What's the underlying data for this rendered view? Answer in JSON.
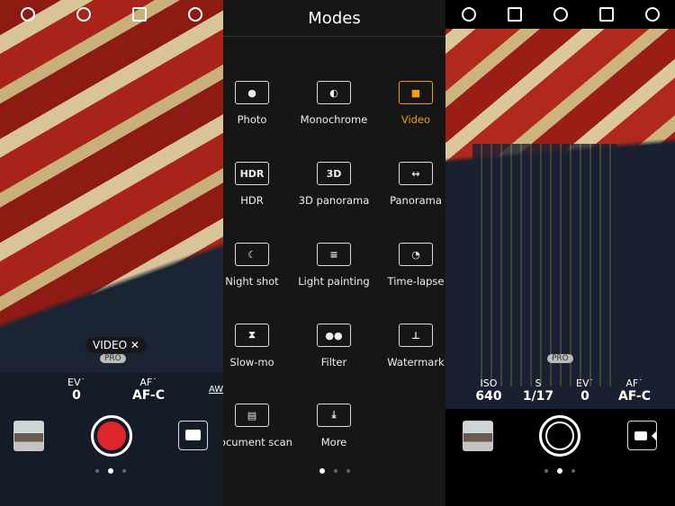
{
  "left": {
    "chip": "VIDEO ✕",
    "pro": "PRO",
    "params": [
      {
        "label": "EV˙",
        "value": "0"
      },
      {
        "label": "AF˙",
        "value": "AF-C"
      }
    ],
    "awb": "AWI",
    "record_color": "#e0262b"
  },
  "modes": {
    "title": "Modes",
    "accent": "#f0a000",
    "items": [
      {
        "label": "Photo",
        "icon": "camera-icon",
        "glyph": "●"
      },
      {
        "label": "Monochrome",
        "icon": "monochrome-icon",
        "glyph": "◐"
      },
      {
        "label": "Video",
        "icon": "video-icon",
        "glyph": "■"
      },
      {
        "label": "HDR",
        "icon": "hdr-icon",
        "glyph": "HDR"
      },
      {
        "label": "3D panorama",
        "icon": "3d-panorama-icon",
        "glyph": "3D"
      },
      {
        "label": "Panorama",
        "icon": "panorama-icon",
        "glyph": "↔"
      },
      {
        "label": "Night shot",
        "icon": "moon-icon",
        "glyph": "☾"
      },
      {
        "label": "Light painting",
        "icon": "light-painting-icon",
        "glyph": "≡"
      },
      {
        "label": "Time-lapse",
        "icon": "time-lapse-icon",
        "glyph": "◔"
      },
      {
        "label": "Slow-mo",
        "icon": "hourglass-icon",
        "glyph": "⧗"
      },
      {
        "label": "Filter",
        "icon": "filter-icon",
        "glyph": "●●"
      },
      {
        "label": "Watermark",
        "icon": "watermark-icon",
        "glyph": "⊥"
      },
      {
        "label": "Document scan",
        "icon": "document-icon",
        "glyph": "▤"
      },
      {
        "label": "More",
        "icon": "download-icon",
        "glyph": "⤓"
      }
    ]
  },
  "right": {
    "pro": "PRO",
    "params": [
      {
        "label": "ISO",
        "value": "640"
      },
      {
        "label": "S",
        "value": "1/17"
      },
      {
        "label": "EV˙",
        "value": "0"
      },
      {
        "label": "AF˙",
        "value": "AF-C"
      }
    ]
  }
}
